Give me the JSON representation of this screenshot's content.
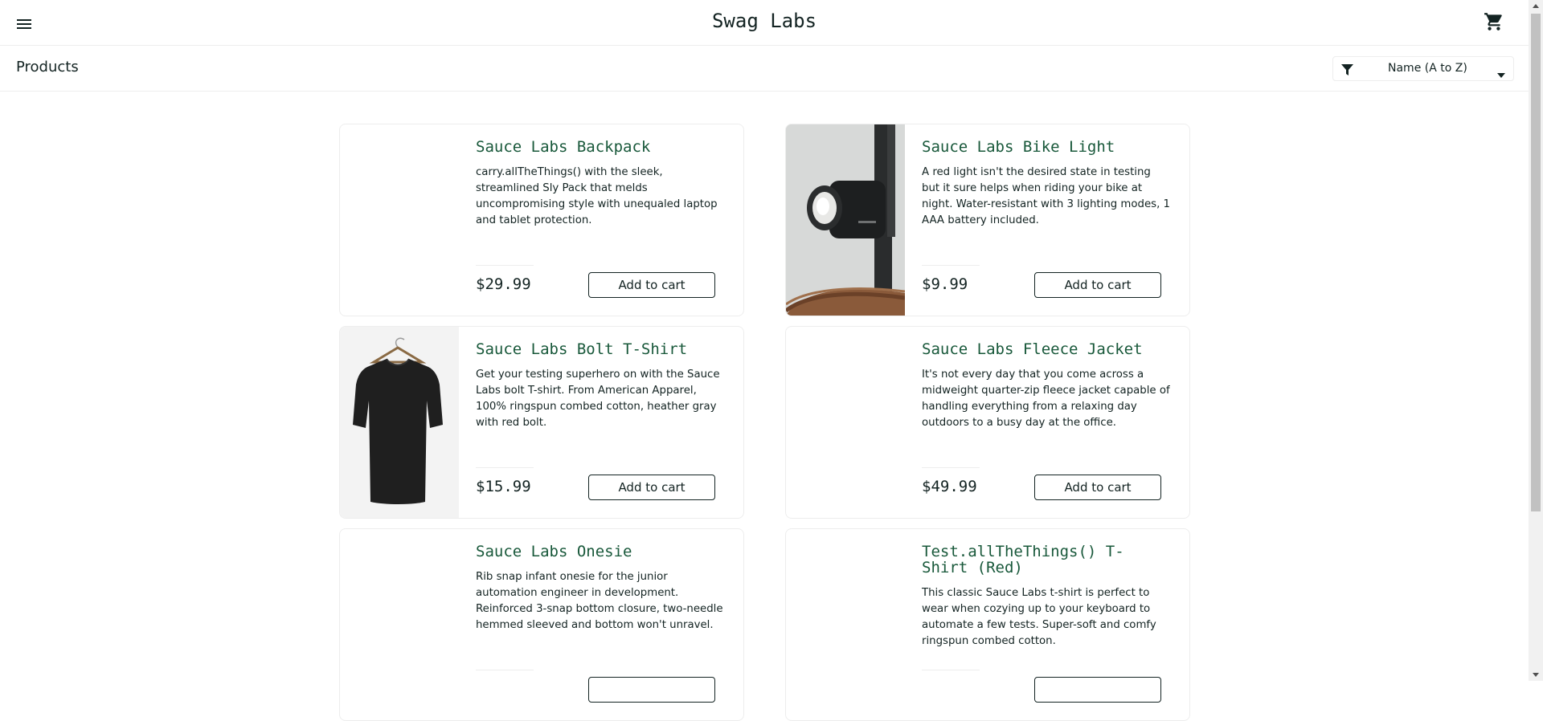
{
  "header": {
    "app_title": "Swag Labs",
    "menu_icon": "hamburger-menu-icon",
    "cart_icon": "shopping-cart-icon"
  },
  "subheader": {
    "title": "Products",
    "sort": {
      "selected": "Name (A to Z)",
      "icon": "filter-icon"
    }
  },
  "products": [
    {
      "name": "Sauce Labs Backpack",
      "description": "carry.allTheThings() with the sleek, streamlined Sly Pack that melds uncompromising style with unequaled laptop and tablet protection.",
      "price": "$29.99",
      "button": "Add to cart"
    },
    {
      "name": "Sauce Labs Bike Light",
      "description": "A red light isn't the desired state in testing but it sure helps when riding your bike at night. Water-resistant with 3 lighting modes, 1 AAA battery included.",
      "price": "$9.99",
      "button": "Add to cart"
    },
    {
      "name": "Sauce Labs Bolt T-Shirt",
      "description": "Get your testing superhero on with the Sauce Labs bolt T-shirt. From American Apparel, 100% ringspun combed cotton, heather gray with red bolt.",
      "price": "$15.99",
      "button": "Add to cart"
    },
    {
      "name": "Sauce Labs Fleece Jacket",
      "description": "It's not every day that you come across a midweight quarter-zip fleece jacket capable of handling everything from a relaxing day outdoors to a busy day at the office.",
      "price": "$49.99",
      "button": "Add to cart"
    },
    {
      "name": "Sauce Labs Onesie",
      "description": "Rib snap infant onesie for the junior automation engineer in development. Reinforced 3-snap bottom closure, two-needle hemmed sleeved and bottom won't unravel."
    },
    {
      "name": "Test.allTheThings() T-Shirt (Red)",
      "description": "This classic Sauce Labs t-shirt is perfect to wear when cozying up to your keyboard to automate a few tests. Super-soft and comfy ringspun combed cotton."
    }
  ],
  "colors": {
    "product_name": "#18583a",
    "text": "#132322",
    "border": "#ededed"
  }
}
